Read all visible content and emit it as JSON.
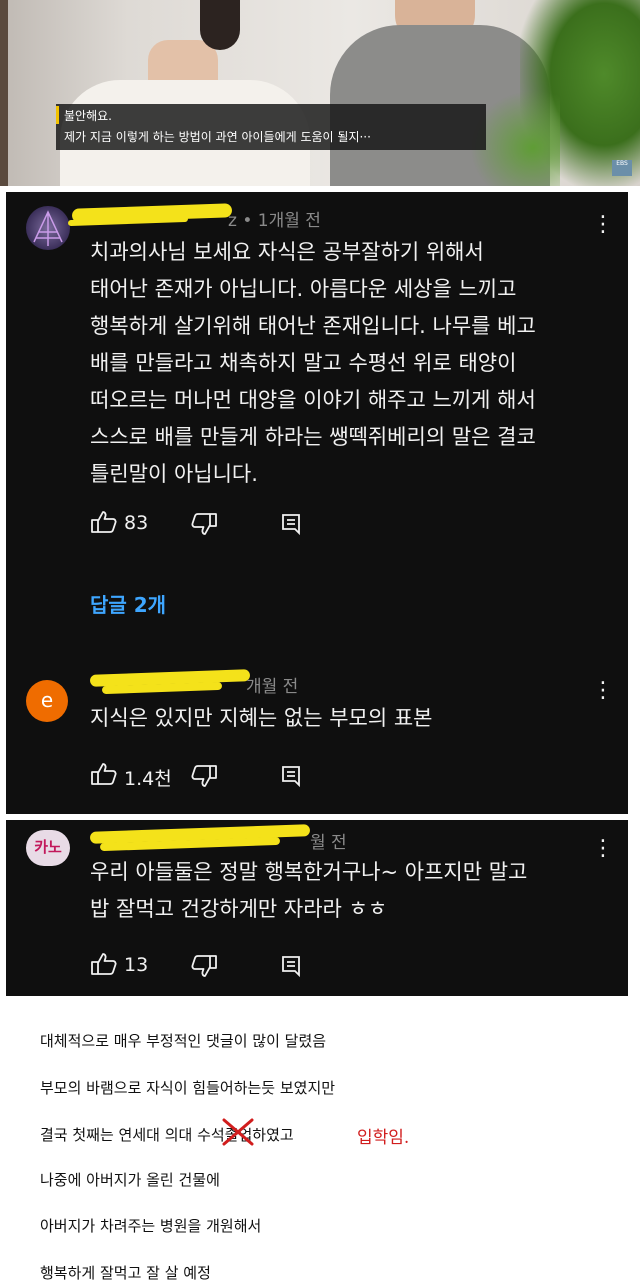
{
  "video": {
    "subtitle_line1": "불안해요.",
    "subtitle_line2": "제가 지금 이렇게 하는 방법이 과연 아이들에게 도움이 될지···",
    "logo": "EBS"
  },
  "comments": [
    {
      "meta": "z • 1개월 전",
      "lines": [
        "치과의사님 보세요 자식은 공부잘하기 위해서",
        "태어난 존재가 아닙니다. 아름다운 세상을 느끼고",
        "행복하게 살기위해 태어난 존재입니다.  나무를 베고",
        "배를 만들라고 채촉하지 말고 수평선 위로 태양이",
        "떠오르는 머나먼 대양을 이야기 해주고 느끼게 해서",
        "스스로 배를 만들게 하라는 쌩떽쥐베리의 말은 결코",
        "틀린말이 아닙니다."
      ],
      "likes": "83",
      "replies_label": "답글 2개"
    },
    {
      "avatar_letter": "e",
      "meta": "개월 전",
      "lines": [
        "지식은 있지만 지혜는 없는 부모의 표본"
      ],
      "likes": "1.4천"
    },
    {
      "avatar_letter": "카노",
      "meta": "월 전",
      "lines": [
        "우리 아들둘은 정말 행복한거구나~ 아프지만 말고",
        "밥 잘먹고 건강하게만 자라라 ㅎㅎ"
      ],
      "likes": "13"
    }
  ],
  "notes": [
    "대체적으로 매우 부정적인 댓글이 많이 달렸음",
    "부모의 바램으로 자식이 힘들어하는듯 보였지만",
    "결국 첫째는 연세대 의대 수석",
    "하였고",
    "나중에 아버지가 올린 건물에",
    "아버지가 차려주는 병원을 개원해서",
    "행복하게 잘먹고 잘 살 예정"
  ],
  "crossed_text": "졸업",
  "red_note": "입학임.",
  "colors": {
    "panel_bg": "#0f0f0f",
    "reply_link": "#3ea6ff",
    "highlight": "#f4e21a",
    "cross": "#d11d1d",
    "avatar_e": "#ef6c00",
    "avatar_kano": "#e8dbe6"
  }
}
